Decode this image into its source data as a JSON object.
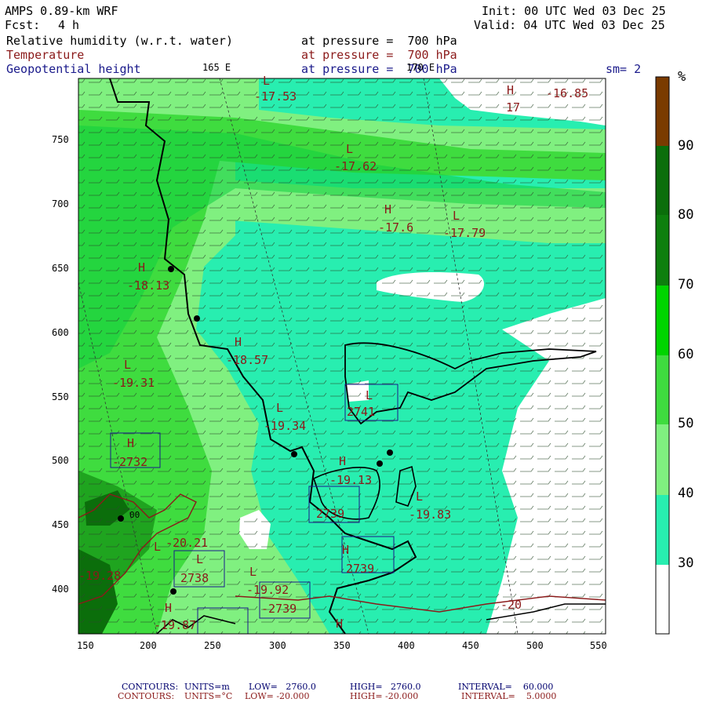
{
  "header": {
    "model": "AMPS 0.89-km WRF",
    "fcst_label": "Fcst:",
    "fcst_value": "4 h",
    "init": "Init: 00 UTC Wed 03 Dec 25",
    "valid": "Valid: 04 UTC Wed 03 Dec 25",
    "fields": [
      {
        "name": "Relative humidity (w.r.t. water)",
        "level": "at pressure =  700 hPa",
        "color": "#000000"
      },
      {
        "name": "Temperature",
        "level": "at pressure =  700 hPa",
        "color": "#8b1a1a"
      },
      {
        "name": "Geopotential height",
        "level": "at pressure =  700 hPa",
        "color": "#1a1a8b"
      }
    ],
    "meridian_labels": [
      "165 E",
      "170 E"
    ],
    "smoothing": "sm= 2"
  },
  "axes": {
    "x_ticks": [
      "150",
      "200",
      "250",
      "300",
      "350",
      "400",
      "450",
      "500",
      "550"
    ],
    "y_ticks": [
      "750",
      "700",
      "650",
      "600",
      "550",
      "500",
      "450",
      "400"
    ]
  },
  "colorbar": {
    "unit": "%",
    "labels": [
      "90",
      "80",
      "70",
      "60",
      "50",
      "40",
      "30"
    ],
    "bands": [
      {
        "range": "90-100",
        "color": "#7a3b00"
      },
      {
        "range": "80-90",
        "color": "#0b6e0b"
      },
      {
        "range": "70-80",
        "color": "#0e7f0e"
      },
      {
        "range": "60-70",
        "color": "#00d400"
      },
      {
        "range": "50-60",
        "color": "#3fdc3f"
      },
      {
        "range": "40-50",
        "color": "#80f080"
      },
      {
        "range": "30-40",
        "color": "#28eeb0"
      },
      {
        "range": "0-30",
        "color": "#ffffff"
      }
    ]
  },
  "labels": {
    "temperature": [
      "-17.53",
      "-16.85",
      "17",
      "-17.62",
      "-17.6",
      "-17.79",
      "-18.13",
      "-18.57",
      "-19.31",
      "-19.34",
      "-19.13",
      "-19.83",
      "-20.21",
      "-19.28",
      "-19.92",
      "-19.87",
      "-20"
    ],
    "highs_lows": [
      "L",
      "H",
      "L",
      "H",
      "L",
      "H",
      "L",
      "L",
      "H",
      "L",
      "H",
      "L",
      "H",
      "L",
      "L",
      "H",
      "L",
      "H",
      "H"
    ],
    "heights": [
      "2741",
      "-2732",
      "2739",
      "2739",
      "2738",
      "-2739",
      "2741",
      "2739"
    ],
    "misc": [
      "00"
    ]
  },
  "footer": {
    "line1": {
      "label": "CONTOURS:",
      "units": "UNITS=m",
      "low": "LOW=   2760.0",
      "high": "HIGH=   2760.0",
      "interval": "INTERVAL=    60.000"
    },
    "line2": {
      "label": "CONTOURS:",
      "units": "UNITS=°C",
      "low": "LOW= -20.000",
      "high": "HIGH= -20.000",
      "interval": "INTERVAL=    5.0000"
    }
  }
}
